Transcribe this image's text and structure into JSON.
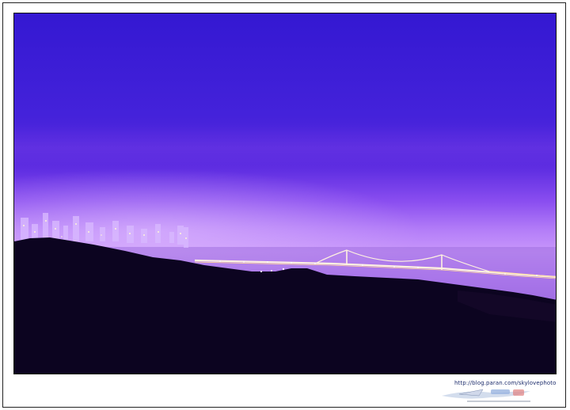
{
  "watermark": {
    "url": "http://blog.paran.com/skylovephoto"
  },
  "scene": {
    "subject": "night-bridge-landscape",
    "colors": {
      "sky_top": "#3a1cd8",
      "sky_mid": "#5a2ee0",
      "horizon_glow": "#c88af8",
      "hills": "#0c0420",
      "bridge_lights": "#fff6e8"
    }
  }
}
